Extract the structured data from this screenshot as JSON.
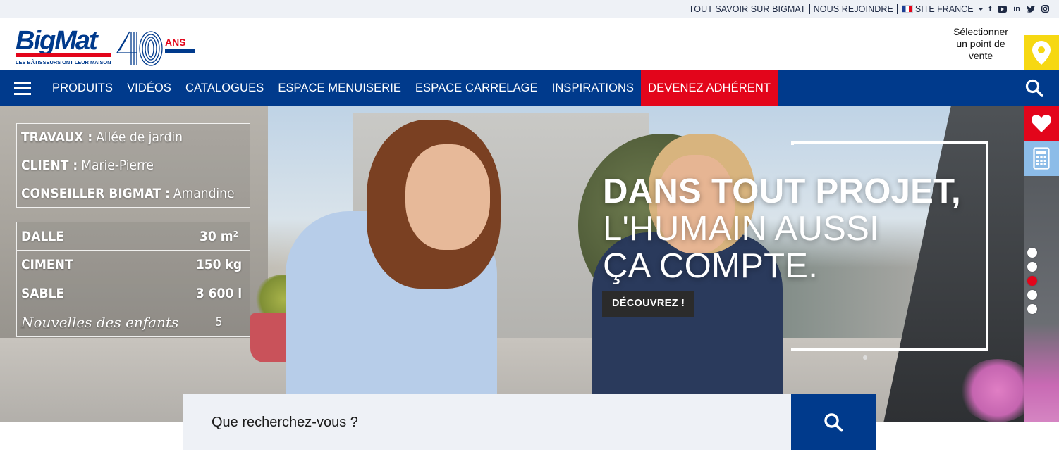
{
  "utility": {
    "link1": "TOUT SAVOIR SUR BIGMAT",
    "link2": "NOUS REJOINDRE",
    "site": "SITE FRANCE",
    "social": [
      "facebook-icon",
      "youtube-icon",
      "linkedin-icon",
      "twitter-icon",
      "instagram-icon"
    ]
  },
  "brand": {
    "name": "BigMat",
    "tagline": "LES BÂTISSEURS ONT LEUR MAISON",
    "anniversary_number": "40",
    "anniversary_label": "ANS",
    "primary_color": "#003a8c",
    "accent_color": "#e3051b"
  },
  "store": {
    "label_line1": "Sélectionner",
    "label_line2": "un point de",
    "label_line3": "vente",
    "color": "#f6d812"
  },
  "nav": {
    "items": [
      {
        "label": "PRODUITS"
      },
      {
        "label": "VIDÉOS"
      },
      {
        "label": "CATALOGUES"
      },
      {
        "label": "ESPACE MENUISERIE"
      },
      {
        "label": "ESPACE CARRELAGE"
      },
      {
        "label": "INSPIRATIONS"
      },
      {
        "label": "DEVENEZ ADHÉRENT"
      }
    ]
  },
  "hero": {
    "work": [
      {
        "key": "TRAVAUX :",
        "value": "Allée de jardin"
      },
      {
        "key": "CLIENT :",
        "value": "Marie-Pierre"
      },
      {
        "key": "CONSEILLER BIGMAT :",
        "value": "Amandine"
      }
    ],
    "materials": [
      {
        "name": "DALLE",
        "value": "30 m²"
      },
      {
        "name": "CIMENT",
        "value": "150 kg"
      },
      {
        "name": "SABLE",
        "value": "3 600 l"
      },
      {
        "name": "Nouvelles des enfants",
        "value": "5"
      }
    ],
    "title_bold": "DANS TOUT PROJET,",
    "title_line2": "L'HUMAIN AUSSI",
    "title_line3": "ÇA COMPTE.",
    "cta": "DÉCOUVREZ !",
    "slides_count": 5,
    "active_slide": 3
  },
  "side_tools": [
    "heart-icon",
    "calculator-icon"
  ],
  "search": {
    "placeholder": "Que recherchez-vous ?"
  }
}
